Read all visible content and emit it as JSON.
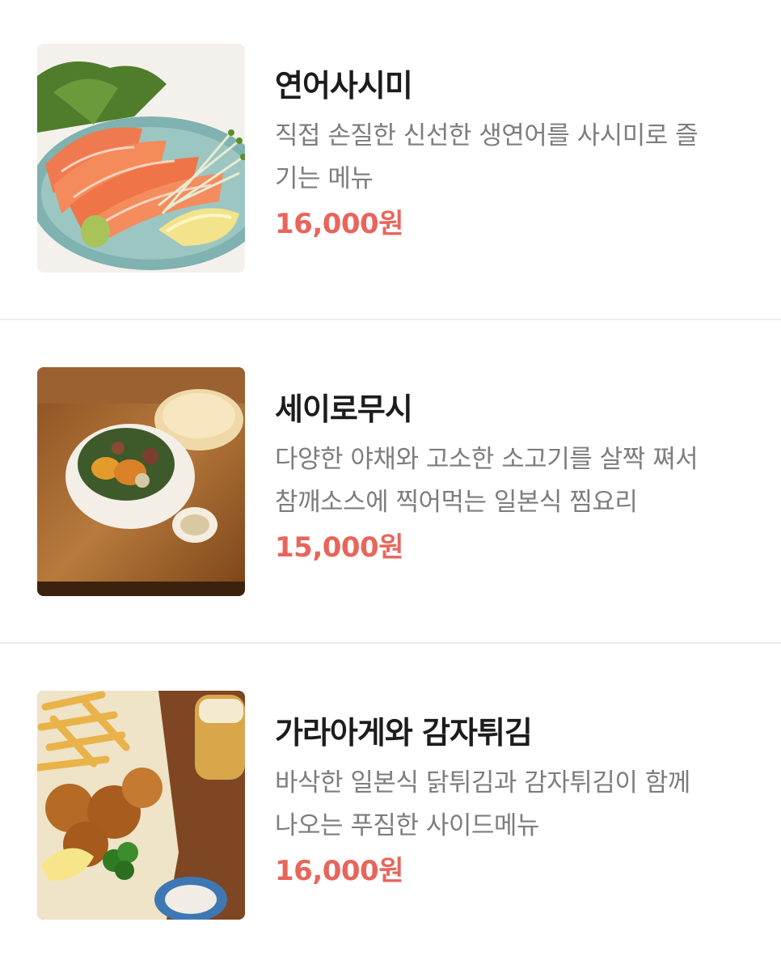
{
  "menu": {
    "items": [
      {
        "name": "연어사시미",
        "desc_line1": "직접 손질한 신선한 생연어를 사시미로 즐",
        "desc_line2": "기는 메뉴",
        "price": "16,000원",
        "image_icon": "salmon-sashimi-image"
      },
      {
        "name": "세이로무시",
        "desc_line1": "다양한 야채와 고소한 소고기를 살짝 쪄서",
        "desc_line2": "참깨소스에 찍어먹는 일본식 찜요리",
        "price": "15,000원",
        "image_icon": "seiromushi-image"
      },
      {
        "name": "가라아게와 감자튀김",
        "desc_line1": "바삭한 일본식 닭튀김과 감자튀김이 함께",
        "desc_line2": "나오는 푸짐한 사이드메뉴",
        "price": "16,000원",
        "image_icon": "karaage-fries-image"
      }
    ]
  },
  "colors": {
    "price": "#e8655b",
    "title": "#1c1c1c",
    "description": "#7d7d7d",
    "divider": "#ececec"
  }
}
